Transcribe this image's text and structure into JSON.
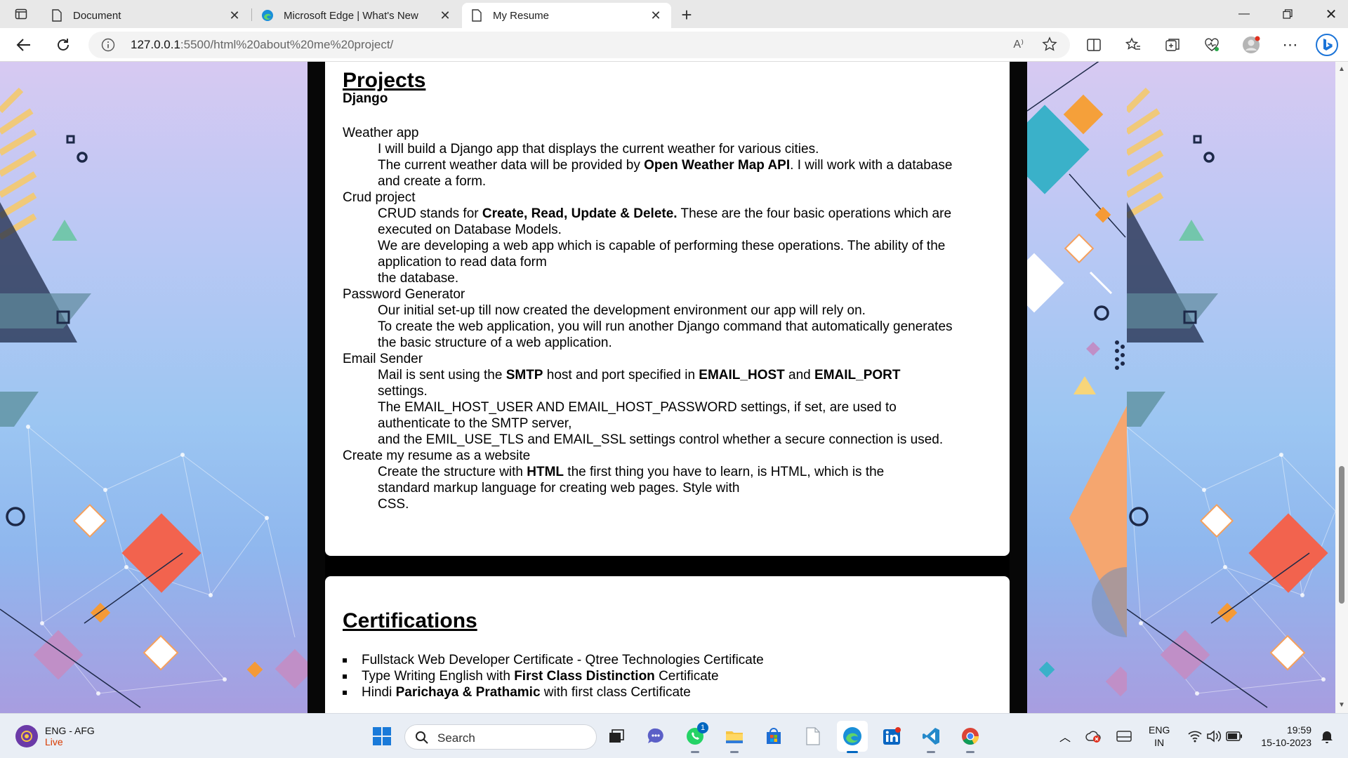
{
  "browser": {
    "tabs": [
      {
        "title": "Document",
        "active": false
      },
      {
        "title": "Microsoft Edge | What's New",
        "active": false
      },
      {
        "title": "My Resume",
        "active": true
      }
    ],
    "address": {
      "host": "127.0.0.1",
      "path": ":5500/html%20about%20me%20project/",
      "read_aloud": "A⁾"
    }
  },
  "projects": {
    "heading": "Projects",
    "subheading": "Django",
    "items": [
      {
        "title": "Weather app",
        "lines": [
          [
            "I will build a Django app that displays the current weather for various cities."
          ],
          [
            "The current weather data will be provided by ",
            {
              "b": "Open Weather Map API"
            },
            ". I will work with a database"
          ],
          [
            "and create a form."
          ]
        ]
      },
      {
        "title": "Crud project",
        "lines": [
          [
            "CRUD stands for ",
            {
              "b": "Create, Read, Update & Delete."
            },
            " These are the four basic operations which are"
          ],
          [
            "executed on Database Models."
          ],
          [
            "We are developing a web app which is capable of performing these operations. The ability of the"
          ],
          [
            "application to read data form"
          ],
          [
            "the database."
          ]
        ]
      },
      {
        "title": "Password Generator",
        "lines": [
          [
            "Our initial set-up till now created the development environment our app will rely on."
          ],
          [
            "To create the web application, you will run another Django command that automatically generates"
          ],
          [
            "the basic structure of a web application."
          ]
        ]
      },
      {
        "title": "Email Sender",
        "lines": [
          [
            "Mail is sent using the ",
            {
              "b": "SMTP"
            },
            " host and port specified in ",
            {
              "b": "EMAIL_HOST"
            },
            " and ",
            {
              "b": "EMAIL_PORT"
            }
          ],
          [
            "settings."
          ],
          [
            "The EMAIL_HOST_USER AND EMAIL_HOST_PASSWORD settings, if set, are used to"
          ],
          [
            "authenticate to the SMTP server,"
          ],
          [
            "and the EMIL_USE_TLS and EMAIL_SSL settings control whether a secure connection is used."
          ]
        ]
      },
      {
        "title": "Create my resume as a website",
        "lines": [
          [
            "Create the structure with ",
            {
              "b": "HTML"
            },
            " the first thing you have to learn, is HTML, which is the"
          ],
          [
            "standard markup language for creating web pages. Style with"
          ],
          [
            "CSS."
          ]
        ]
      }
    ]
  },
  "certifications": {
    "heading": "Certifications",
    "items": [
      [
        "Fullstack Web Developer Certificate - Qtree Technologies Certificate"
      ],
      [
        "Type Writing English with ",
        {
          "b": "First Class Distinction"
        },
        " Certificate"
      ],
      [
        "Hindi ",
        {
          "b": "Parichaya & Prathamic"
        },
        " with first class Certificate"
      ]
    ]
  },
  "taskbar": {
    "weather": {
      "line1": "ENG - AFG",
      "line2": "Live"
    },
    "search_placeholder": "Search",
    "whatsapp_badge": "1",
    "apps": [
      "task-view-icon",
      "chat-icon",
      "whatsapp-icon",
      "file-explorer-icon",
      "store-icon",
      "blank-file-icon",
      "edge-icon",
      "linkedin-icon",
      "vscode-icon",
      "chrome-icon"
    ],
    "language": {
      "line1": "ENG",
      "line2": "IN"
    },
    "clock": {
      "time": "19:59",
      "date": "15-10-2023"
    }
  }
}
